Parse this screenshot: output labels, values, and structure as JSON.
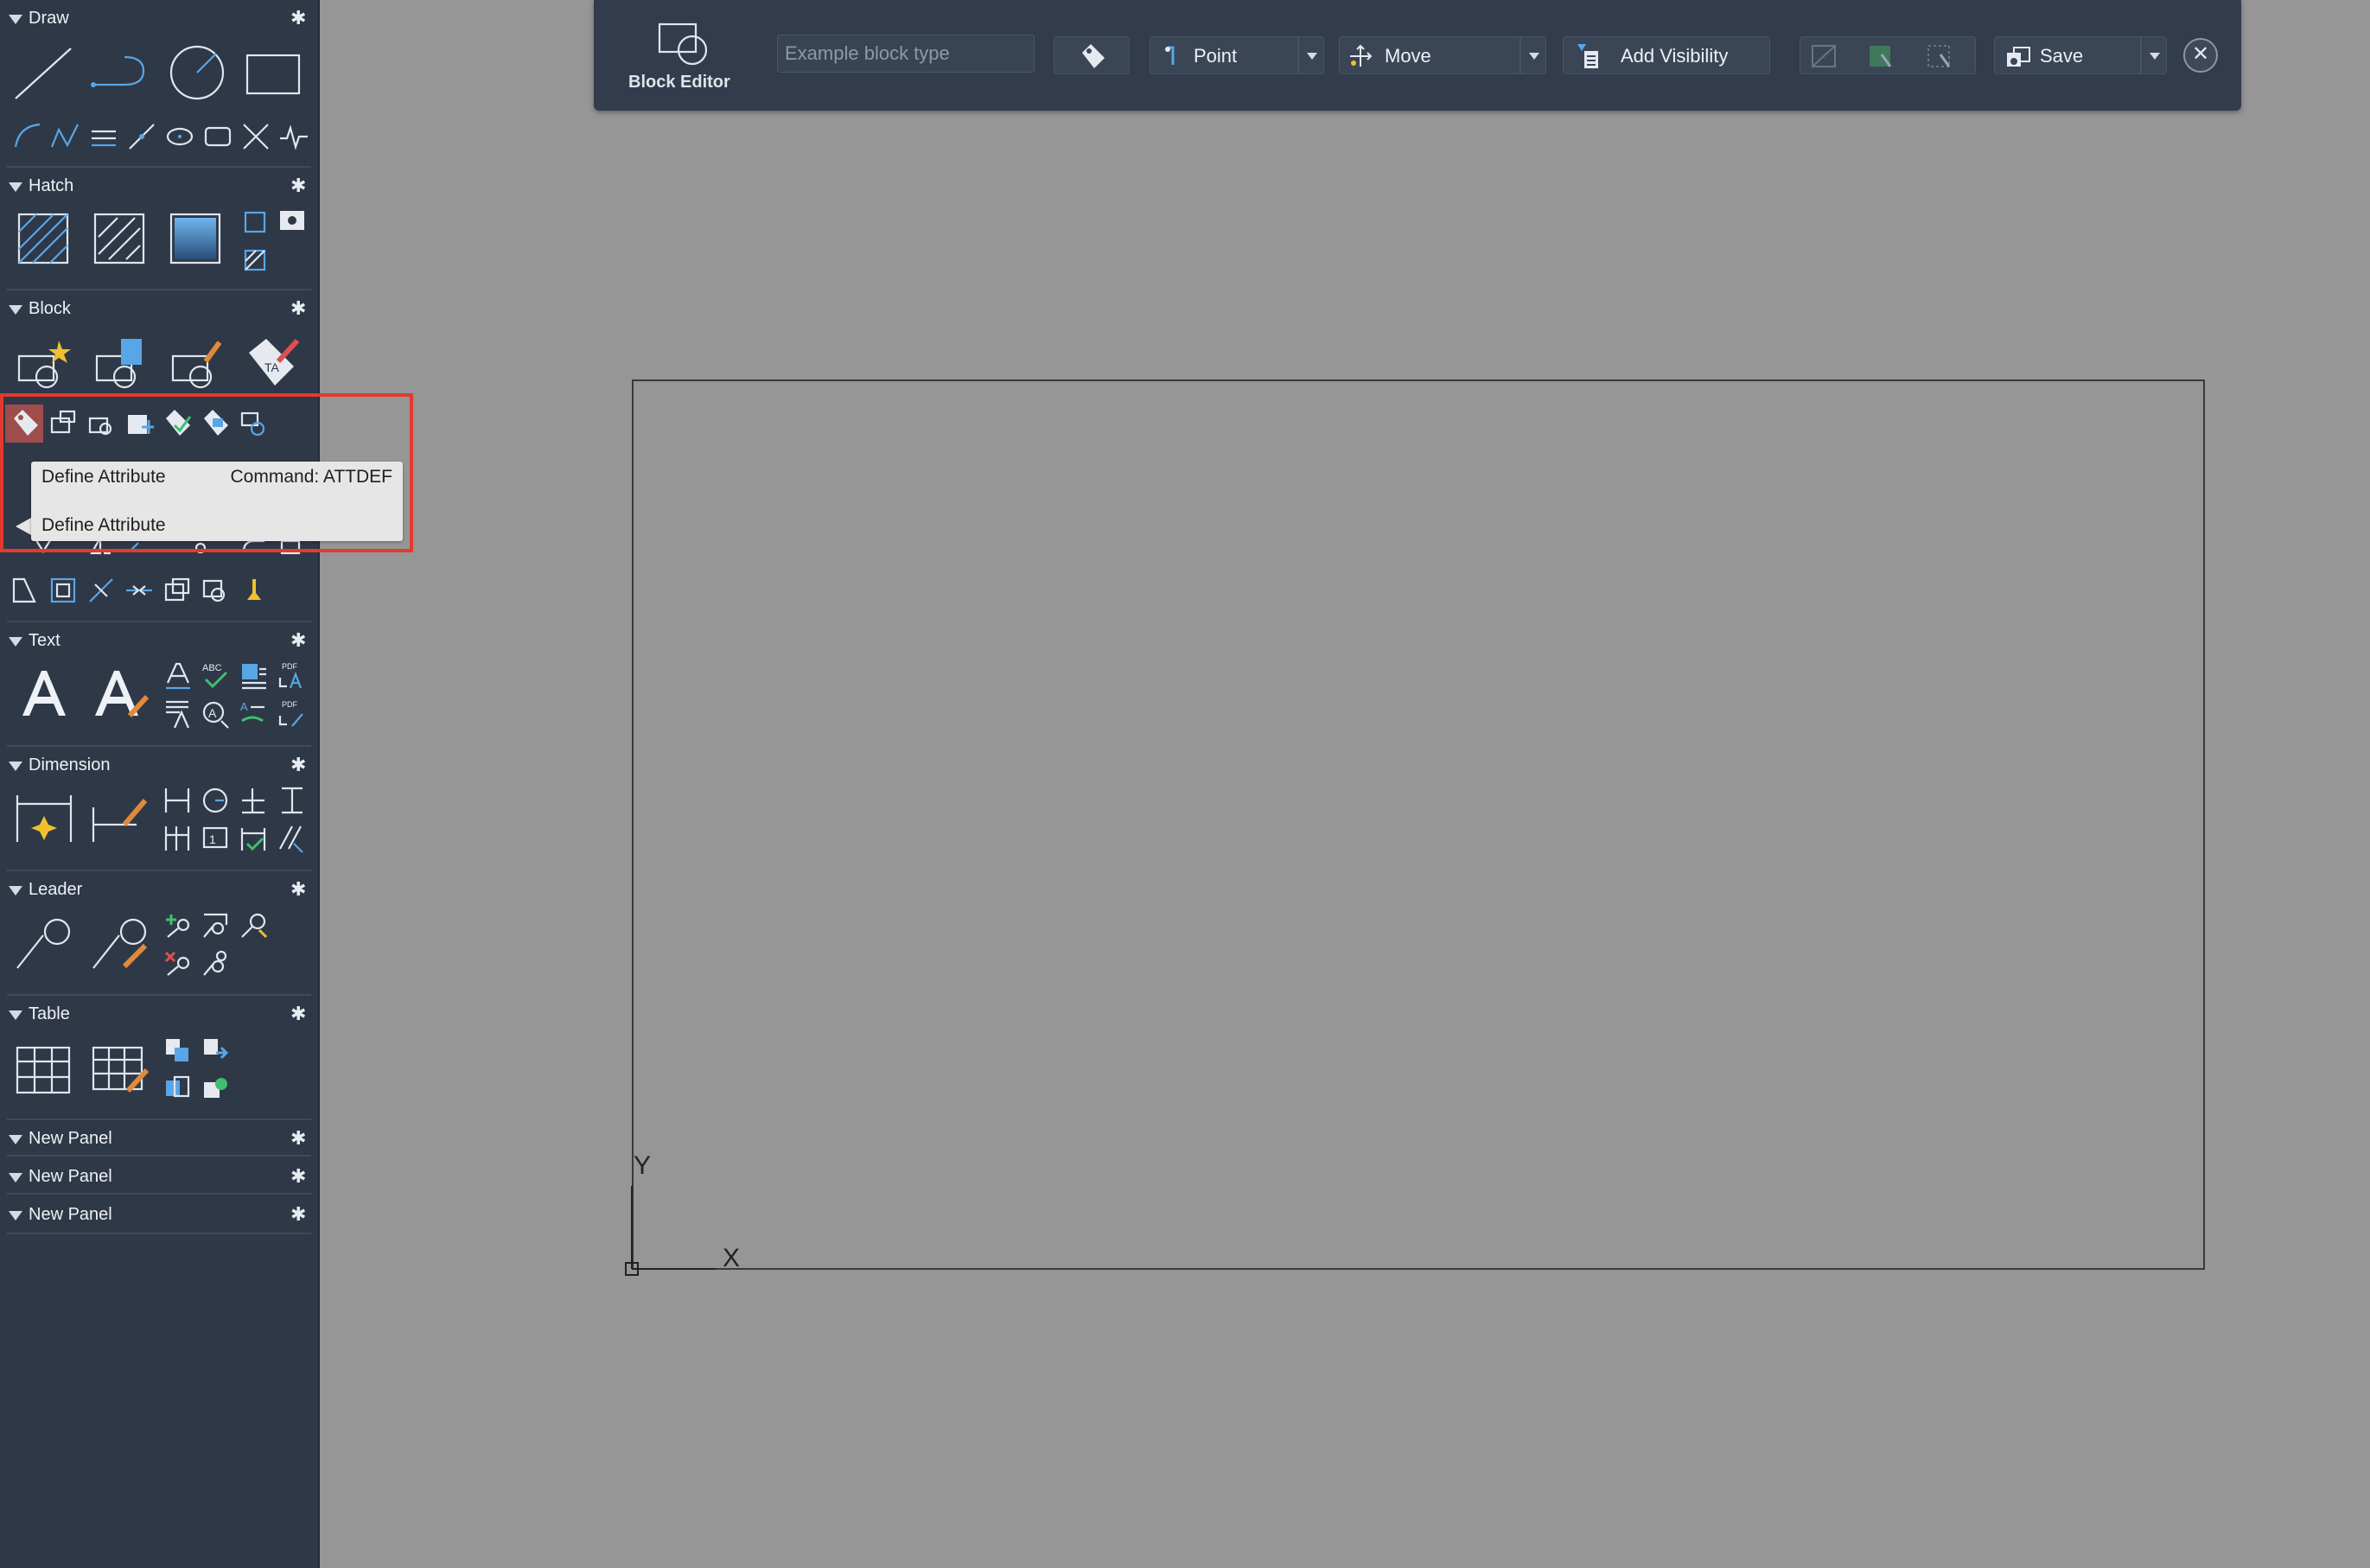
{
  "palette": {
    "panels": [
      {
        "title": "Draw"
      },
      {
        "title": "Hatch"
      },
      {
        "title": "Block"
      },
      {
        "title": "Text"
      },
      {
        "title": "Dimension"
      },
      {
        "title": "Leader"
      },
      {
        "title": "Table"
      },
      {
        "title": "New Panel"
      },
      {
        "title": "New Panel"
      },
      {
        "title": "New Panel"
      }
    ]
  },
  "tooltip": {
    "title": "Define Attribute",
    "command": "Command: ATTDEF",
    "description": "Define Attribute"
  },
  "toolbar": {
    "block_editor_label": "Block Editor",
    "block_type_placeholder": "Example block type",
    "point_label": "Point",
    "move_label": "Move",
    "add_visibility_label": "Add Visibility",
    "save_label": "Save",
    "close_symbol": "✕"
  },
  "canvas": {
    "ucs_y_label": "Y",
    "ucs_x_label": "X"
  },
  "colors": {
    "palette_bg": "#2f3847",
    "canvas_bg": "#969696",
    "toolbar_bg": "#323c4c",
    "highlight": "#e23b2e",
    "icon_blue": "#59a6e6"
  }
}
